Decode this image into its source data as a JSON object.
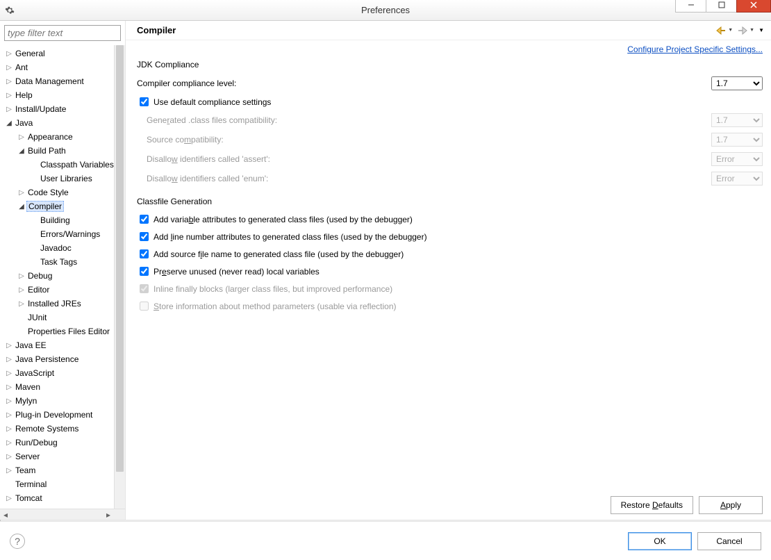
{
  "window": {
    "title": "Preferences"
  },
  "filter_placeholder": "type filter text",
  "tree": [
    {
      "label": "General",
      "depth": 0,
      "exp": "closed"
    },
    {
      "label": "Ant",
      "depth": 0,
      "exp": "closed"
    },
    {
      "label": "Data Management",
      "depth": 0,
      "exp": "closed"
    },
    {
      "label": "Help",
      "depth": 0,
      "exp": "closed"
    },
    {
      "label": "Install/Update",
      "depth": 0,
      "exp": "closed"
    },
    {
      "label": "Java",
      "depth": 0,
      "exp": "open"
    },
    {
      "label": "Appearance",
      "depth": 1,
      "exp": "closed"
    },
    {
      "label": "Build Path",
      "depth": 1,
      "exp": "open"
    },
    {
      "label": "Classpath Variables",
      "depth": 2,
      "exp": "none"
    },
    {
      "label": "User Libraries",
      "depth": 2,
      "exp": "none"
    },
    {
      "label": "Code Style",
      "depth": 1,
      "exp": "closed"
    },
    {
      "label": "Compiler",
      "depth": 1,
      "exp": "open",
      "selected": true
    },
    {
      "label": "Building",
      "depth": 2,
      "exp": "none"
    },
    {
      "label": "Errors/Warnings",
      "depth": 2,
      "exp": "none"
    },
    {
      "label": "Javadoc",
      "depth": 2,
      "exp": "none"
    },
    {
      "label": "Task Tags",
      "depth": 2,
      "exp": "none"
    },
    {
      "label": "Debug",
      "depth": 1,
      "exp": "closed"
    },
    {
      "label": "Editor",
      "depth": 1,
      "exp": "closed"
    },
    {
      "label": "Installed JREs",
      "depth": 1,
      "exp": "closed"
    },
    {
      "label": "JUnit",
      "depth": 1,
      "exp": "none"
    },
    {
      "label": "Properties Files Editor",
      "depth": 1,
      "exp": "none"
    },
    {
      "label": "Java EE",
      "depth": 0,
      "exp": "closed"
    },
    {
      "label": "Java Persistence",
      "depth": 0,
      "exp": "closed"
    },
    {
      "label": "JavaScript",
      "depth": 0,
      "exp": "closed"
    },
    {
      "label": "Maven",
      "depth": 0,
      "exp": "closed"
    },
    {
      "label": "Mylyn",
      "depth": 0,
      "exp": "closed"
    },
    {
      "label": "Plug-in Development",
      "depth": 0,
      "exp": "closed"
    },
    {
      "label": "Remote Systems",
      "depth": 0,
      "exp": "closed"
    },
    {
      "label": "Run/Debug",
      "depth": 0,
      "exp": "closed"
    },
    {
      "label": "Server",
      "depth": 0,
      "exp": "closed"
    },
    {
      "label": "Team",
      "depth": 0,
      "exp": "closed"
    },
    {
      "label": "Terminal",
      "depth": 0,
      "exp": "none"
    },
    {
      "label": "Tomcat",
      "depth": 0,
      "exp": "closed"
    }
  ],
  "page": {
    "title": "Compiler",
    "config_link": "Configure Project Specific Settings..."
  },
  "jdk": {
    "title": "JDK Compliance",
    "level_label": "Compiler compliance level:",
    "level_value": "1.7",
    "use_default": "Use default compliance settings",
    "gen_class": "Generated .class files compatibility:",
    "gen_class_value": "1.7",
    "source_compat": "Source compatibility:",
    "source_compat_value": "1.7",
    "assert_label": "Disallow identifiers called 'assert':",
    "assert_value": "Error",
    "enum_label": "Disallow identifiers called 'enum':",
    "enum_value": "Error"
  },
  "classfile": {
    "title": "Classfile Generation",
    "c1": "Add variable attributes to generated class files (used by the debugger)",
    "c2": "Add line number attributes to generated class files (used by the debugger)",
    "c3": "Add source file name to generated class file (used by the debugger)",
    "c4": "Preserve unused (never read) local variables",
    "c5": "Inline finally blocks (larger class files, but improved performance)",
    "c6": "Store information about method parameters (usable via reflection)"
  },
  "buttons": {
    "restore": "Restore Defaults",
    "apply": "Apply",
    "ok": "OK",
    "cancel": "Cancel"
  }
}
